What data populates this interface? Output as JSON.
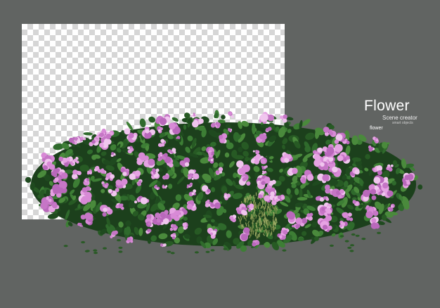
{
  "brand": {
    "title": "Flower",
    "subtitle": "Scene creator",
    "tagline": "smart objects"
  },
  "label": "flower",
  "colors": {
    "background": "#616462",
    "checker_light": "#ffffff",
    "checker_dark": "#d6d6d6",
    "leaf_dark": "#1f4a1f",
    "leaf_mid": "#2f6a2c",
    "leaf_light": "#4a8a3c",
    "flower_pink": "#d88ad6",
    "flower_light": "#f0c6ee",
    "grass": "#9aa862"
  }
}
